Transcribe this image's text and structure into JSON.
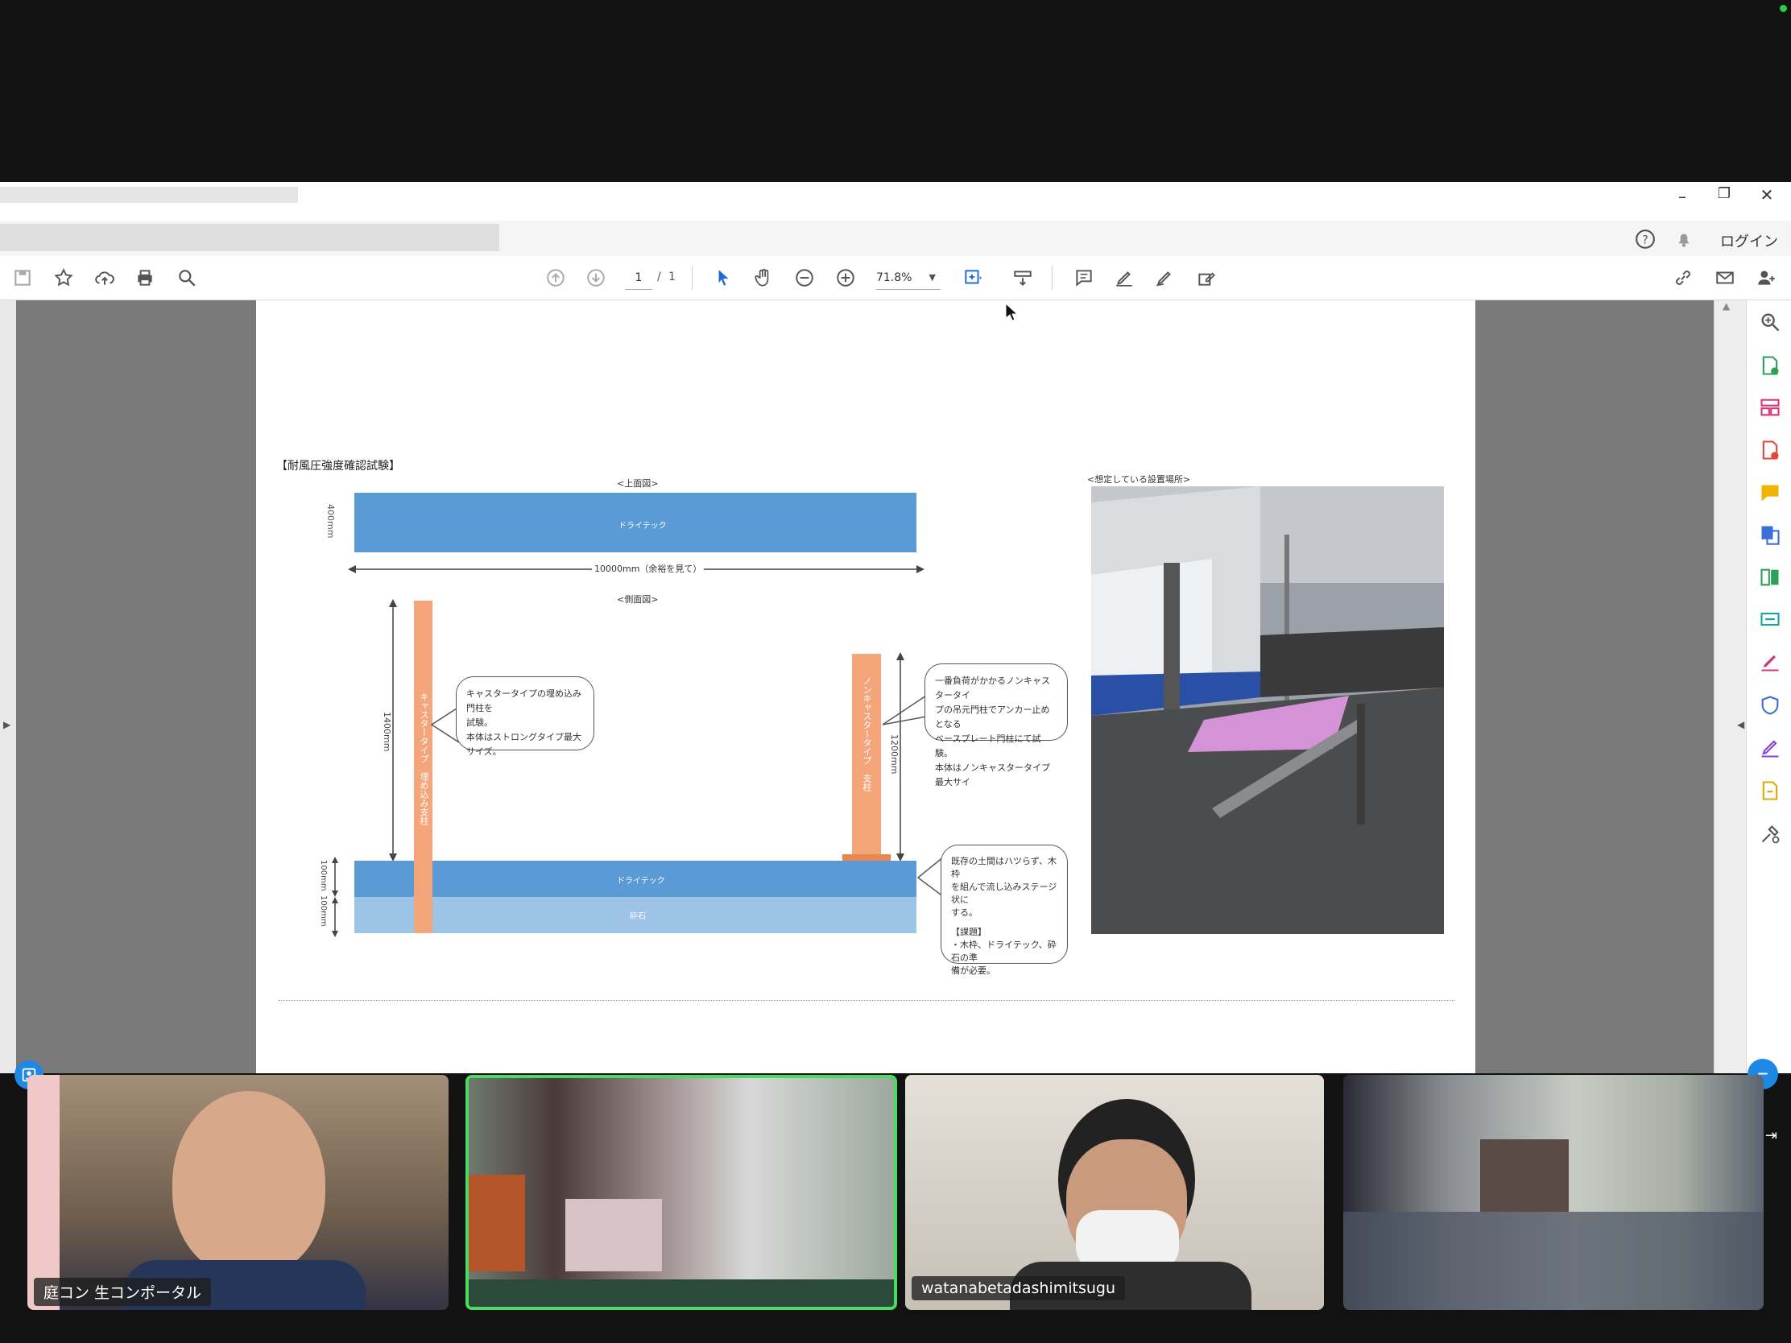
{
  "window": {
    "controls": {
      "minimize": "–",
      "restore": "❐",
      "close": "✕"
    }
  },
  "menubar": {
    "login": "ログイン"
  },
  "toolbar": {
    "page_current": "1",
    "page_separator": "/",
    "page_total": "1",
    "zoom": "71.8%"
  },
  "document": {
    "heading": "【耐風圧強度確認試験】",
    "top_view_label": "<上面図>",
    "side_view_label": "<側面図>",
    "photo_label": "<想定している設置場所>",
    "drytech_top": "ドライテック",
    "dim_400": "400mm",
    "dim_10000": "10000mm（余裕を見て）",
    "dim_1400": "1400mm",
    "dim_1200": "1200mm",
    "dim_100_top": "100mm",
    "dim_100_bottom": "100mm",
    "drytech_bottom": "ドライテック",
    "gravel": "砕石",
    "pillar_left": "キャスタータイプ　埋め込み支柱",
    "pillar_right": "ノンキャスタータイプ　支柱",
    "bubble1": [
      "キャスタータイプの埋め込み門柱を",
      "試験。",
      "本体はストロングタイプ最大サイズ。"
    ],
    "bubble2": [
      "一番負荷がかかるノンキャスタータイ",
      "プの吊元門柱でアンカー止めとなる",
      "ベースプレート門柱にて試験。",
      "本体はノンキャスタータイプ最大サイ"
    ],
    "bubble3": [
      "既存の土間はハツらず、木枠",
      "を組んで流し込みステージ状に",
      "する。",
      "",
      "【課題】",
      "・木枠、ドライテック、砕石の準",
      "備が必要。"
    ]
  },
  "participants": [
    {
      "name": "庭コン 生コンポータル"
    },
    {
      "name": ""
    },
    {
      "name": "watanabetadashimitsugu"
    },
    {
      "name": ""
    }
  ],
  "colors": {
    "drytech": "#5b9bd5",
    "gravel": "#9dc3e6",
    "pillar": "#f4a57a",
    "active_speaker": "#4cd964",
    "accent": "#1e88e5"
  }
}
